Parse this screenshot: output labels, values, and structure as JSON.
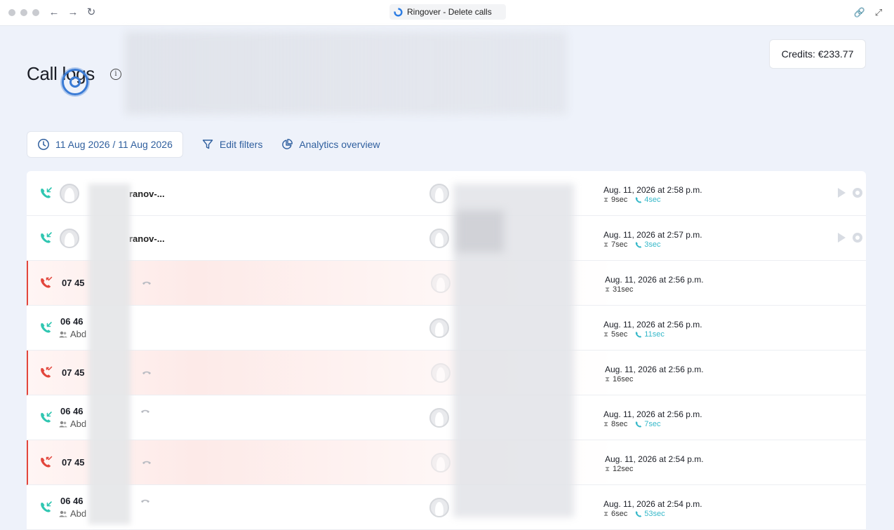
{
  "window": {
    "tab_title": "Ringover - Delete calls"
  },
  "header": {
    "title": "Call logs",
    "credits": "Credits: €233.77"
  },
  "filters": {
    "date_range": "11 Aug 2026 / 11 Aug 2026",
    "edit_filters": "Edit filters",
    "analytics": "Analytics overview"
  },
  "colors": {
    "incoming": "#2fc6b1",
    "missed": "#e2453b",
    "talk_time": "#35b8c9",
    "link": "#2f5f9e"
  },
  "rows": [
    {
      "type": "incoming",
      "contact": "ranov-...",
      "date": "Aug. 11, 2026 at 2:58 p.m.",
      "total": "9sec",
      "talk": "4sec"
    },
    {
      "type": "incoming",
      "contact": "ranov-...",
      "date": "Aug. 11, 2026 at 2:57 p.m.",
      "total": "7sec",
      "talk": "3sec"
    },
    {
      "type": "missed",
      "number": "07 45",
      "date": "Aug. 11, 2026 at 2:56 p.m.",
      "total": "31sec"
    },
    {
      "type": "incoming",
      "number": "06 46",
      "sub": "Abd",
      "date": "Aug. 11, 2026 at 2:56 p.m.",
      "total": "5sec",
      "talk": "11sec"
    },
    {
      "type": "missed",
      "number": "07 45",
      "date": "Aug. 11, 2026 at 2:56 p.m.",
      "total": "16sec"
    },
    {
      "type": "incoming",
      "number": "06 46",
      "sub": "Abd",
      "date": "Aug. 11, 2026 at 2:56 p.m.",
      "total": "8sec",
      "talk": "7sec"
    },
    {
      "type": "missed",
      "number": "07 45",
      "date": "Aug. 11, 2026 at 2:54 p.m.",
      "total": "12sec"
    },
    {
      "type": "incoming",
      "number": "06 46",
      "sub": "Abd",
      "date": "Aug. 11, 2026 at 2:54 p.m.",
      "total": "6sec",
      "talk": "53sec"
    }
  ]
}
